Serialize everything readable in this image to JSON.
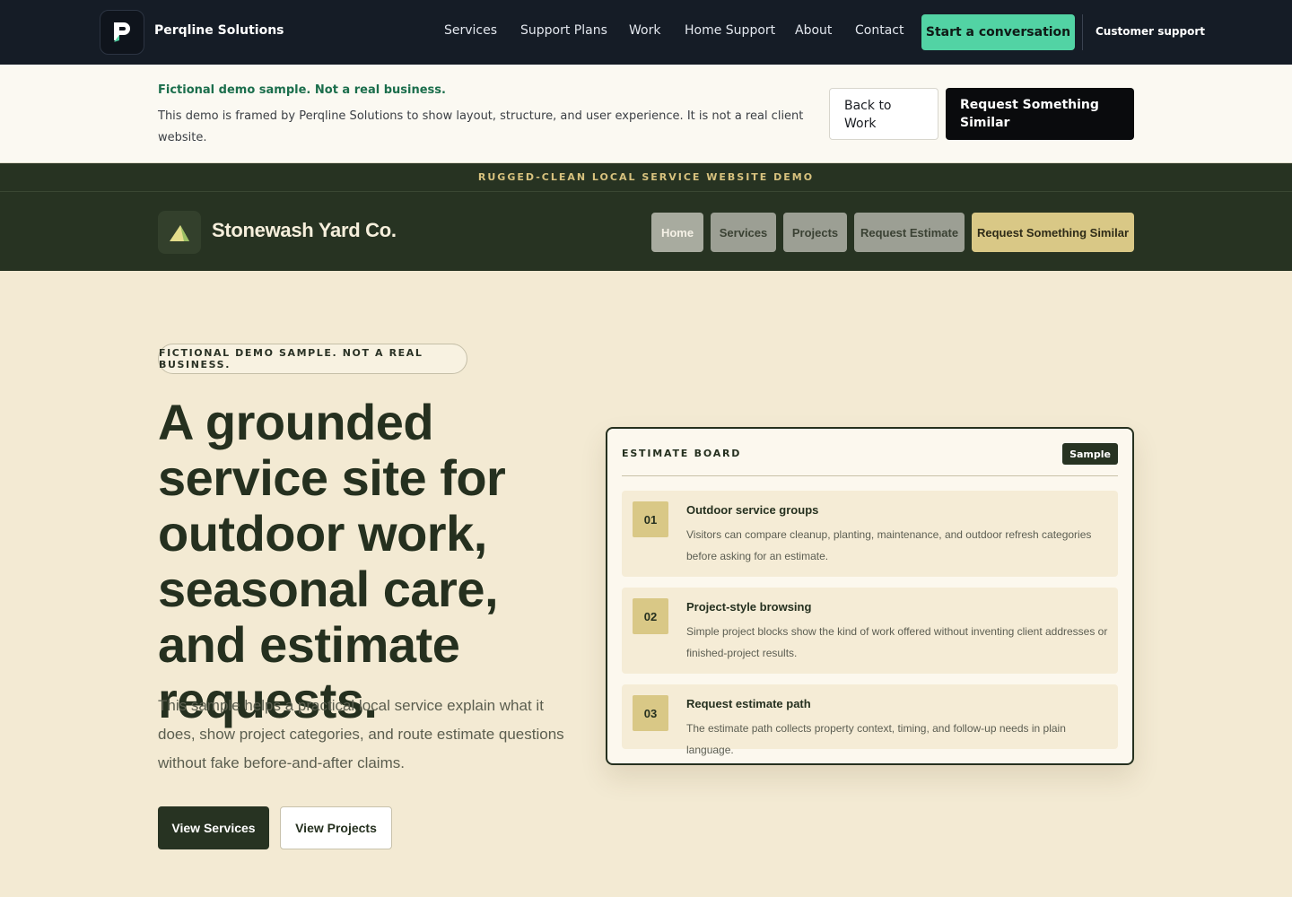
{
  "agency": {
    "name": "Perqline Solutions",
    "nav": [
      "Services",
      "Support Plans",
      "Work",
      "Home Support",
      "About",
      "Contact"
    ],
    "cta": "Start a conversation",
    "support": "Customer support"
  },
  "notice": {
    "title": "Fictional demo sample. Not a real business.",
    "body": "This demo is framed by Perqline Solutions to show layout, structure, and user experience. It is not a real client website.",
    "back_button": "Back to Work",
    "request_button": "Request Something Similar"
  },
  "demo_strip": "RUGGED-CLEAN LOCAL SERVICE WEBSITE DEMO",
  "site": {
    "name": "Stonewash Yard Co.",
    "nav": [
      "Home",
      "Services",
      "Projects",
      "Request Estimate"
    ],
    "cta": "Request Something Similar"
  },
  "hero": {
    "pill": "FICTIONAL DEMO SAMPLE. NOT A REAL BUSINESS.",
    "title": "A grounded service site for outdoor work, seasonal care, and estimate requests.",
    "subtitle": "This sample helps a practical local service explain what it does, show project categories, and route estimate questions without fake before-and-after claims.",
    "primary_button": "View Services",
    "secondary_button": "View Projects"
  },
  "board": {
    "title": "ESTIMATE BOARD",
    "badge": "Sample",
    "items": [
      {
        "num": "01",
        "title": "Outdoor service groups",
        "desc": "Visitors can compare cleanup, planting, maintenance, and outdoor refresh categories before asking for an estimate."
      },
      {
        "num": "02",
        "title": "Project-style browsing",
        "desc": "Simple project blocks show the kind of work offered without inventing client addresses or finished-project results."
      },
      {
        "num": "03",
        "title": "Request estimate path",
        "desc": "The estimate path collects property context, timing, and follow-up needs in plain language."
      }
    ]
  },
  "colors": {
    "agency_bg": "#151c26",
    "agency_accent": "#52d3a4",
    "site_dark": "#273322",
    "site_gold": "#d9c886",
    "cream": "#f3ead3"
  }
}
